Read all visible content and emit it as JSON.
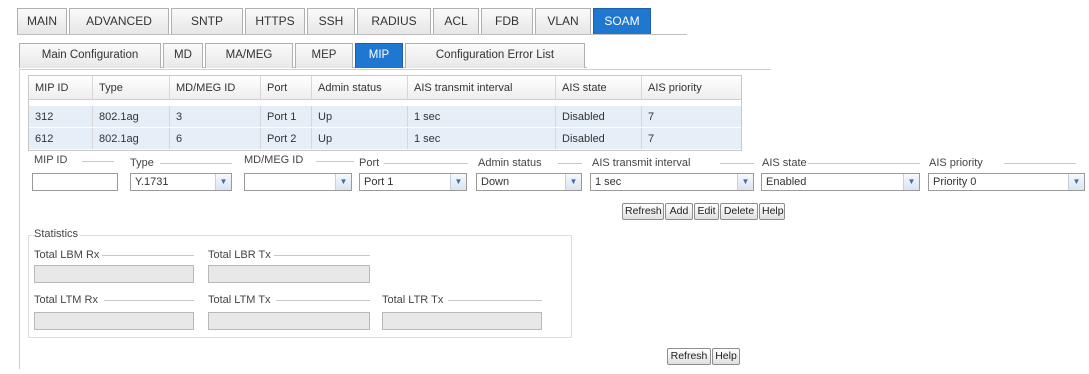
{
  "top_tabs": [
    "MAIN",
    "ADVANCED",
    "SNTP",
    "HTTPS",
    "SSH",
    "RADIUS",
    "ACL",
    "FDB",
    "VLAN",
    "SOAM"
  ],
  "sub_tabs": [
    "Main Configuration",
    "MD",
    "MA/MEG",
    "MEP",
    "MIP",
    "Configuration Error List"
  ],
  "table": {
    "headers": [
      "MIP ID",
      "Type",
      "MD/MEG ID",
      "Port",
      "Admin status",
      "AIS transmit interval",
      "AIS state",
      "AIS priority"
    ],
    "rows": [
      [
        "312",
        "802.1ag",
        "3",
        "Port 1",
        "Up",
        "1 sec",
        "Disabled",
        "7"
      ],
      [
        "612",
        "802.1ag",
        "6",
        "Port 2",
        "Up",
        "1 sec",
        "Disabled",
        "7"
      ]
    ]
  },
  "form": {
    "labels": [
      "MIP ID",
      "Type",
      "MD/MEG ID",
      "Port",
      "Admin status",
      "AIS transmit interval",
      "AIS state",
      "AIS priority"
    ],
    "values": [
      "",
      "Y.1731",
      "",
      "Port 1",
      "Down",
      "1 sec",
      "Enabled",
      "Priority 0"
    ],
    "buttons": [
      "Refresh",
      "Add",
      "Edit",
      "Delete",
      "Help"
    ]
  },
  "statistics": {
    "title": "Statistics",
    "labels": [
      "Total LBM Rx",
      "Total LBR Tx",
      "Total LTM Rx",
      "Total LTM Tx",
      "Total LTR Tx"
    ]
  },
  "bottom_buttons": [
    "Refresh",
    "Help"
  ],
  "colors": {
    "active_tab": "#1f77d0",
    "row_highlight": "#e6eef7"
  }
}
